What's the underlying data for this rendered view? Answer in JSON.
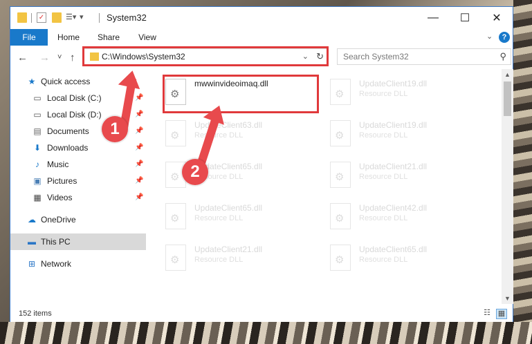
{
  "window": {
    "title": "System32",
    "controls": {
      "minimize": "—",
      "maximize": "☐",
      "close": "✕"
    }
  },
  "ribbon": {
    "tabs": [
      "File",
      "Home",
      "Share",
      "View"
    ],
    "expand": "⌄",
    "help": "?"
  },
  "nav": {
    "back": "←",
    "forward": "→",
    "recent": "˅",
    "up": "↑",
    "address": "C:\\Windows\\System32",
    "refresh": "↻",
    "search_placeholder": "Search System32",
    "search_icon": "⚲"
  },
  "sidebar": {
    "items": [
      {
        "label": "Quick access",
        "icon": "★",
        "pinned": false
      },
      {
        "label": "Local Disk (C:)",
        "icon": "▭",
        "pinned": true
      },
      {
        "label": "Local Disk (D:)",
        "icon": "▭",
        "pinned": true
      },
      {
        "label": "Documents",
        "icon": "▤",
        "pinned": true
      },
      {
        "label": "Downloads",
        "icon": "⬇",
        "pinned": true
      },
      {
        "label": "Music",
        "icon": "♪",
        "pinned": true
      },
      {
        "label": "Pictures",
        "icon": "▣",
        "pinned": true
      },
      {
        "label": "Videos",
        "icon": "▦",
        "pinned": true
      },
      {
        "label": "OneDrive",
        "icon": "☁",
        "pinned": false
      },
      {
        "label": "This PC",
        "icon": "▬",
        "pinned": false
      },
      {
        "label": "Network",
        "icon": "⊞",
        "pinned": false
      }
    ],
    "pin_icon": "📌"
  },
  "files": {
    "highlight": {
      "name": "mwwinvideoimaq.dll"
    },
    "column1": [
      {
        "name": "UpdateClient63.dll",
        "type": "Resource DLL"
      },
      {
        "name": "UpdateClient65.dll",
        "type": "Resource DLL"
      },
      {
        "name": "UpdateClient65.dll",
        "type": "Resource DLL"
      },
      {
        "name": "UpdateClient21.dll",
        "type": "Resource DLL"
      }
    ],
    "column2": [
      {
        "name": "UpdateClient19.dll",
        "type": "Resource DLL"
      },
      {
        "name": "UpdateClient19.dll",
        "type": "Resource DLL"
      },
      {
        "name": "UpdateClient21.dll",
        "type": "Resource DLL"
      },
      {
        "name": "UpdateClient42.dll",
        "type": "Resource DLL"
      },
      {
        "name": "UpdateClient65.dll",
        "type": "Resource DLL"
      }
    ]
  },
  "status": {
    "item_count": "152 items"
  },
  "annotations": {
    "step1": "1",
    "step2": "2"
  },
  "colors": {
    "accent": "#1979ca",
    "highlight_red": "#e0393b",
    "badge_red": "#e84a4d"
  }
}
